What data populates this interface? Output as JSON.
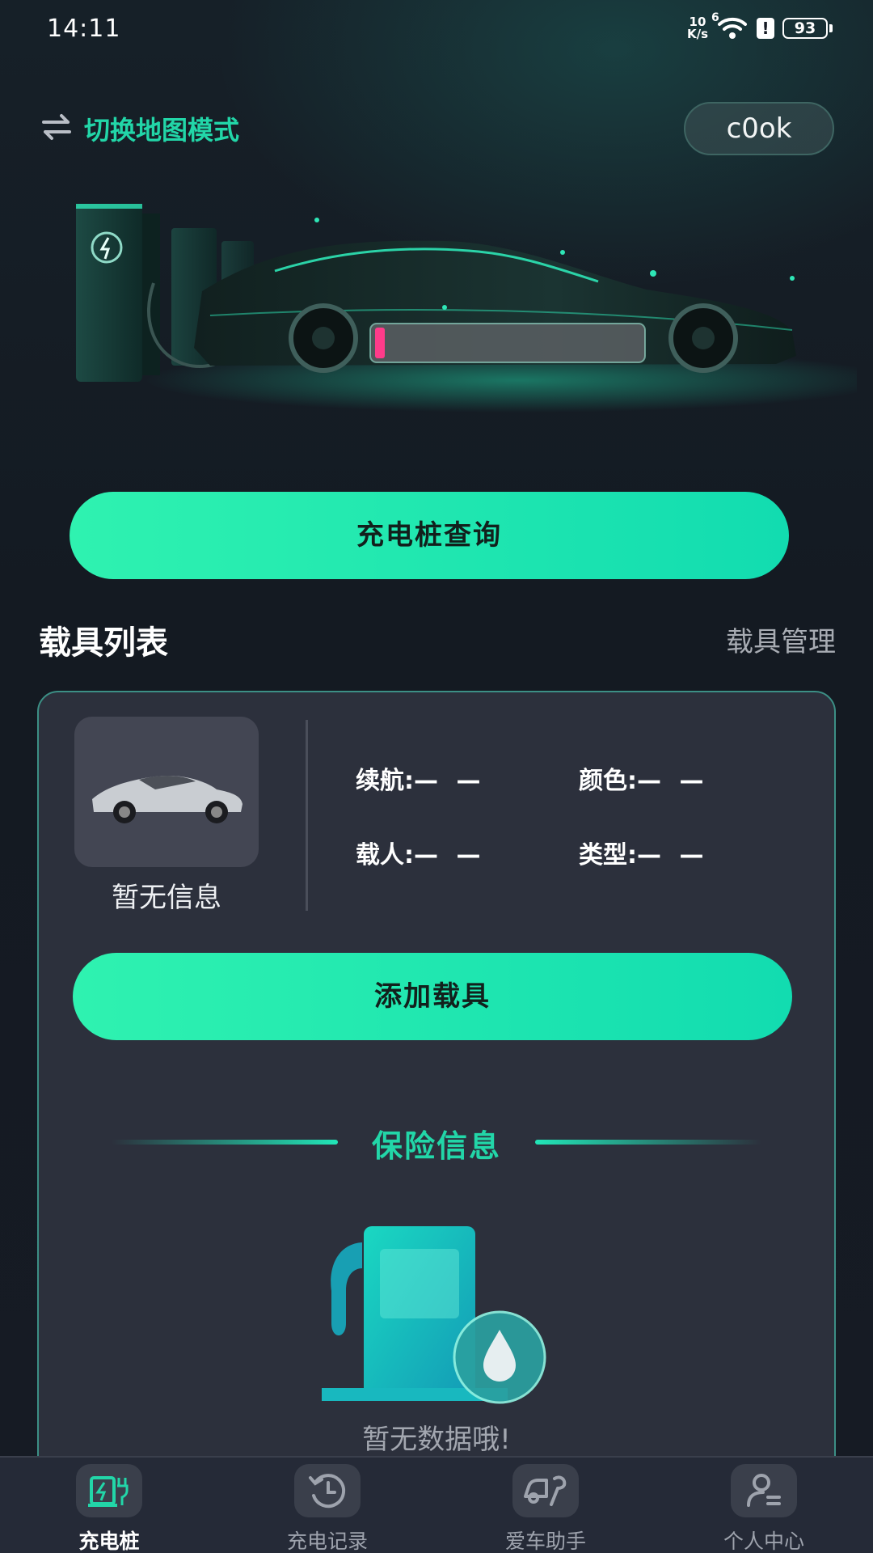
{
  "status_bar": {
    "time": "14:11",
    "net_speed_value": "10",
    "net_speed_unit": "K/s",
    "wifi_badge": "6",
    "alert_badge": "!",
    "battery": "93"
  },
  "header": {
    "switch_map_label": "切换地图模式",
    "user_name": "c0ok"
  },
  "actions": {
    "query_button": "充电桩查询"
  },
  "vehicle_section": {
    "title": "载具列表",
    "manage_link": "载具管理",
    "card": {
      "caption": "暂无信息",
      "specs": [
        {
          "label": "续航:",
          "value": "— —"
        },
        {
          "label": "颜色:",
          "value": "— —"
        },
        {
          "label": "载人:",
          "value": "— —"
        },
        {
          "label": "类型:",
          "value": "— —"
        }
      ],
      "add_button": "添加载具"
    }
  },
  "insurance": {
    "title": "保险信息",
    "empty_text": "暂无数据哦!"
  },
  "bottom_nav": {
    "items": [
      {
        "label": "充电桩",
        "icon": "charging-station-icon",
        "active": true
      },
      {
        "label": "充电记录",
        "icon": "history-icon",
        "active": false
      },
      {
        "label": "爱车助手",
        "icon": "car-wrench-icon",
        "active": false
      },
      {
        "label": "个人中心",
        "icon": "user-profile-icon",
        "active": false
      }
    ]
  },
  "colors": {
    "accent": "#22d6a8",
    "button_gradient_start": "#2ff2b0",
    "button_gradient_end": "#12dcb0",
    "card_bg": "#2c303c",
    "page_bg": "#161b24"
  }
}
